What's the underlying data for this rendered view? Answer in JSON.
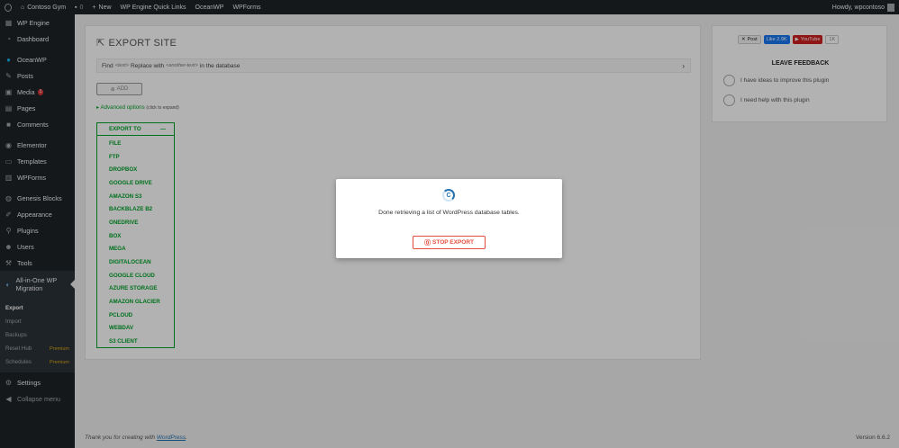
{
  "adminbar": {
    "site_name": "Contoso Gym",
    "comments_count": "0",
    "new_label": "New",
    "links": [
      "WP Engine Quick Links",
      "OceanWP",
      "WPForms"
    ],
    "howdy": "Howdy, wpcontoso"
  },
  "sidebar": {
    "items": [
      {
        "label": "WP Engine",
        "icon": "wpengine-icon"
      },
      {
        "label": "Dashboard",
        "icon": "dashboard-icon"
      },
      {
        "label": "OceanWP",
        "icon": "oceanwp-icon"
      },
      {
        "label": "Posts",
        "icon": "pin-icon"
      },
      {
        "label": "Media",
        "icon": "media-icon",
        "badge": "1"
      },
      {
        "label": "Pages",
        "icon": "pages-icon"
      },
      {
        "label": "Comments",
        "icon": "comments-icon"
      },
      {
        "label": "Elementor",
        "icon": "elementor-icon"
      },
      {
        "label": "Templates",
        "icon": "folder-icon"
      },
      {
        "label": "WPForms",
        "icon": "forms-icon"
      },
      {
        "label": "Genesis Blocks",
        "icon": "genesis-icon"
      },
      {
        "label": "Appearance",
        "icon": "brush-icon"
      },
      {
        "label": "Plugins",
        "icon": "plugin-icon"
      },
      {
        "label": "Users",
        "icon": "users-icon"
      },
      {
        "label": "Tools",
        "icon": "wrench-icon"
      }
    ],
    "active": {
      "label": "All-in-One WP Migration",
      "icon": "migration-icon"
    },
    "submenu": [
      {
        "label": "Export",
        "premium": ""
      },
      {
        "label": "Import",
        "premium": ""
      },
      {
        "label": "Backups",
        "premium": ""
      },
      {
        "label": "Reset Hub",
        "premium": "Premium"
      },
      {
        "label": "Schedules",
        "premium": "Premium"
      }
    ],
    "settings": "Settings",
    "collapse": "Collapse menu"
  },
  "main": {
    "title": "EXPORT SITE",
    "find_label": "Find",
    "find_placeholder": "<text>",
    "replace_label": "Replace with",
    "replace_placeholder": "<another-text>",
    "in_db": "in the database",
    "add_label": "ADD",
    "advanced_label": "Advanced options",
    "advanced_hint": "(click to expand)",
    "export_to": "EXPORT TO",
    "export_targets": [
      "FILE",
      "FTP",
      "DROPBOX",
      "GOOGLE DRIVE",
      "AMAZON S3",
      "BACKBLAZE B2",
      "ONEDRIVE",
      "BOX",
      "MEGA",
      "DIGITALOCEAN",
      "GOOGLE CLOUD",
      "AZURE STORAGE",
      "AMAZON GLACIER",
      "PCLOUD",
      "WEBDAV",
      "S3 CLIENT"
    ]
  },
  "side": {
    "post_label": "Post",
    "fb_label": "Like 2.9K",
    "yt_label": "YouTube",
    "yt_count": "1K",
    "feedback_title": "LEAVE FEEDBACK",
    "option_ideas": "I have ideas to improve this plugin",
    "option_help": "I need help with this plugin"
  },
  "footer": {
    "thanks": "Thank you for creating with",
    "wp_link": "WordPress",
    "version": "Version 6.6.2"
  },
  "modal": {
    "message": "Done retrieving a list of WordPress database tables.",
    "stop_label": "STOP EXPORT"
  }
}
